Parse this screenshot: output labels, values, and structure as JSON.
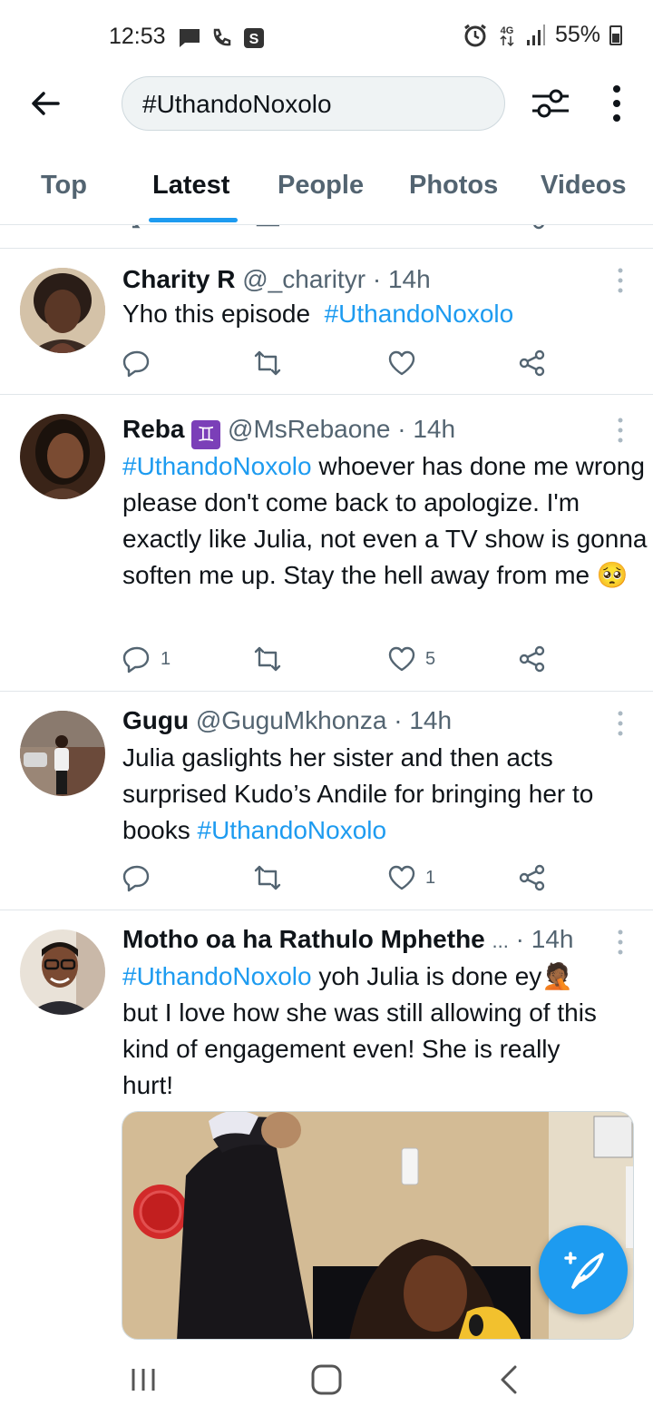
{
  "status_bar": {
    "time": "12:53",
    "battery": "55%",
    "network": "4G",
    "icons_left": [
      "message-icon",
      "phone-icon",
      "s-app-icon"
    ],
    "icons_right": [
      "alarm-icon",
      "network-icon",
      "signal-icon",
      "battery-icon"
    ]
  },
  "topbar": {
    "search_value": "#UthandoNoxolo",
    "icons": [
      "back-arrow-icon",
      "filter-sliders-icon",
      "more-vertical-icon"
    ]
  },
  "tabs": [
    {
      "label": "Top",
      "active": false
    },
    {
      "label": "Latest",
      "active": true
    },
    {
      "label": "People",
      "active": false
    },
    {
      "label": "Photos",
      "active": false
    },
    {
      "label": "Videos",
      "active": false
    }
  ],
  "tweets": [
    {
      "name": "Charity R",
      "handle": "@_charityr",
      "dot": "·",
      "time": "14h",
      "text_parts": [
        "Yho this episode",
        "#UthandoNoxolo"
      ],
      "reply_count": "",
      "like_count": ""
    },
    {
      "name": "Reba",
      "badge": "♊",
      "handle": "@MsRebaone",
      "dot": "·",
      "time": "14h",
      "hashtag": "#UthandoNoxolo",
      "text": "whoever has done me wrong please don't come back to apologize. I'm exactly like Julia, not even a TV show is gonna soften me up. Stay the hell away from me",
      "emoji": "🥺",
      "reply_count": "1",
      "like_count": "5"
    },
    {
      "name": "Gugu",
      "handle": "@GuguMkhonza",
      "dot": "·",
      "time": "14h",
      "text": "Julia gaslights her sister and then acts surprised Kudo’s Andile for bringing her to books",
      "hashtag": "#UthandoNoxolo",
      "reply_count": "",
      "like_count": "1"
    },
    {
      "name": "Motho oa ha Rathulo Mphethe",
      "ellipsis": "...",
      "dot": "·",
      "time": "14h",
      "hashtag": "#UthandoNoxolo",
      "text_a": "yoh Julia is done ey",
      "emoji": "🤦🏾",
      "text_b": "but I love how she was still allowing of this kind of engagement even! She is really hurt!"
    }
  ],
  "colors": {
    "accent": "#1d9bf0",
    "text": "#0f1419",
    "secondary": "#536471",
    "divider": "#e1e6ea"
  },
  "fab": {
    "icon": "compose-tweet-icon"
  },
  "navbar": {
    "icons": [
      "recent-apps-icon",
      "home-icon",
      "back-icon"
    ]
  }
}
